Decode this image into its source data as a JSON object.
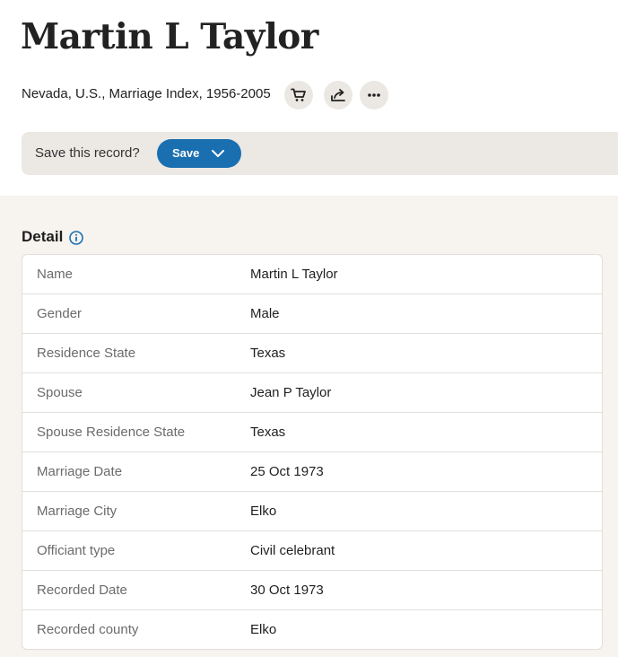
{
  "record": {
    "title": "Martin L Taylor",
    "collection": "Nevada, U.S., Marriage Index, 1956-2005"
  },
  "actions": {
    "cart_icon": "cart-icon",
    "share_icon": "share-icon",
    "more_icon": "more-icon"
  },
  "savebar": {
    "question": "Save this record?",
    "save_label": "Save"
  },
  "detail": {
    "heading": "Detail",
    "rows": [
      {
        "label": "Name",
        "value": "Martin L Taylor"
      },
      {
        "label": "Gender",
        "value": "Male"
      },
      {
        "label": "Residence State",
        "value": "Texas"
      },
      {
        "label": "Spouse",
        "value": "Jean P Taylor"
      },
      {
        "label": "Spouse Residence State",
        "value": "Texas"
      },
      {
        "label": "Marriage Date",
        "value": "25 Oct 1973"
      },
      {
        "label": "Marriage City",
        "value": "Elko"
      },
      {
        "label": "Officiant type",
        "value": "Civil celebrant"
      },
      {
        "label": "Recorded Date",
        "value": "30 Oct 1973"
      },
      {
        "label": "Recorded county",
        "value": "Elko"
      }
    ]
  },
  "colors": {
    "accent": "#1a6fb0",
    "savebar_bg": "#ece8e4",
    "section_bg": "#f7f3ef"
  }
}
